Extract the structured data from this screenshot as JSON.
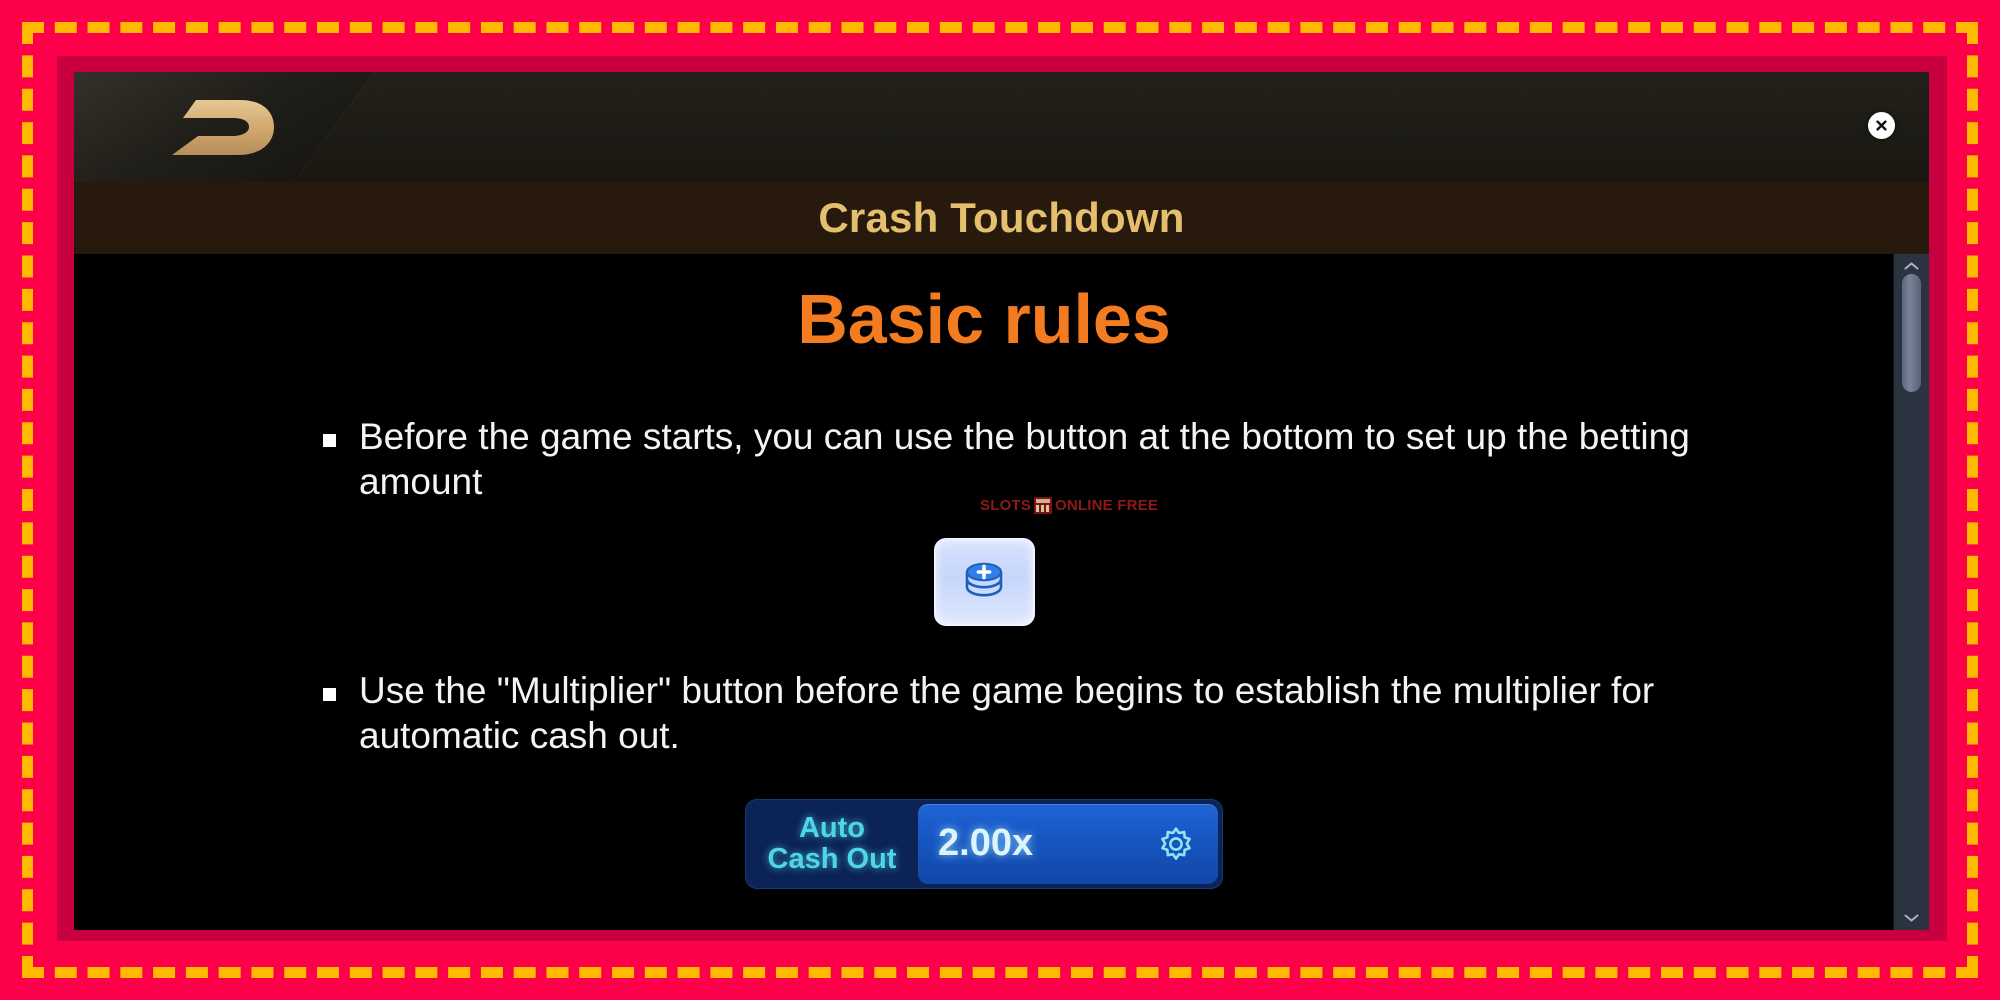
{
  "frame": {
    "outer_color": "#FC0049",
    "dash_color": "#FFB900",
    "bevel_color": "#C90040"
  },
  "window": {
    "background": "#000000",
    "logo": {
      "name": "brand-d-logo",
      "color": "#d9b37d"
    },
    "close_button": {
      "label": "×",
      "name": "close-icon"
    }
  },
  "titlebar": {
    "title": "Crash Touchdown",
    "color": "#e3bf6e",
    "background": "#271a0d"
  },
  "content": {
    "heading": "Basic rules",
    "heading_color": "#F47C20",
    "rules": [
      "Before the game starts, you can use the button at the bottom to set up the betting amount",
      "Use the \"Multiplier\" button before the game begins to establish the multiplier for automatic cash out."
    ],
    "coin_button": {
      "name": "add-coins-button",
      "accent": "#1f6fe0",
      "background": "#cedcfb"
    },
    "auto_cash_out": {
      "label_line1": "Auto",
      "label_line2": "Cash Out",
      "value": "2.00x",
      "label_color": "#4fd5e8",
      "value_color": "#ddf4fb",
      "box_color": "#1553bd",
      "panel_color": "#0b2355",
      "gear_icon": "settings-gear-icon"
    }
  },
  "watermark": {
    "word1": "SLOTS",
    "word2": "ONLINE FREE",
    "color": "#8c1a18"
  },
  "scrollbar": {
    "track_color": "#2b3240",
    "thumb_color": "#79839a"
  }
}
